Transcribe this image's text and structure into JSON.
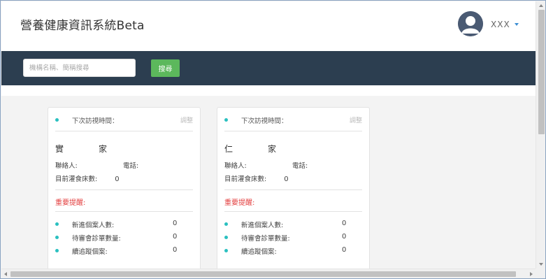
{
  "app": {
    "title": "營養健康資訊系統Beta"
  },
  "user": {
    "name": "XXX"
  },
  "search": {
    "placeholder": "機構名稱、簡稱搜尋",
    "button_label": "搜尋"
  },
  "cards": [
    {
      "visit_label": "下次訪視時間：",
      "adjust_label": "調整",
      "facility_char1": "實",
      "facility_char2": "家",
      "contact_label": "聯絡人:",
      "phone_label": "電話:",
      "feeding_label": "目前灌食床數:",
      "feeding_value": "0",
      "alert_title": "重要提醒:",
      "stats": [
        {
          "label": "新進個案人數:",
          "value": "0"
        },
        {
          "label": "待審會診單數量:",
          "value": "0"
        },
        {
          "label": "續追蹤個案:",
          "value": "0"
        }
      ]
    },
    {
      "visit_label": "下次訪視時間：",
      "adjust_label": "調整",
      "facility_char1": "仁",
      "facility_char2": "家",
      "contact_label": "聯絡人:",
      "phone_label": "電話:",
      "feeding_label": "目前灌食床數:",
      "feeding_value": "0",
      "alert_title": "重要提醒:",
      "stats": [
        {
          "label": "新進個案人數:",
          "value": "0"
        },
        {
          "label": "待審會診單數量:",
          "value": "0"
        },
        {
          "label": "續追蹤個案:",
          "value": "0"
        }
      ]
    }
  ],
  "colors": {
    "nav_bar": "#2c3e50",
    "search_button": "#5cb85c",
    "bullet": "#2ac0c0",
    "alert": "#e34040",
    "user_caret": "#3b8ed3"
  },
  "icons": {
    "avatar": "user-avatar-icon",
    "caret": "caret-down-icon",
    "bullet": "dot-icon"
  }
}
